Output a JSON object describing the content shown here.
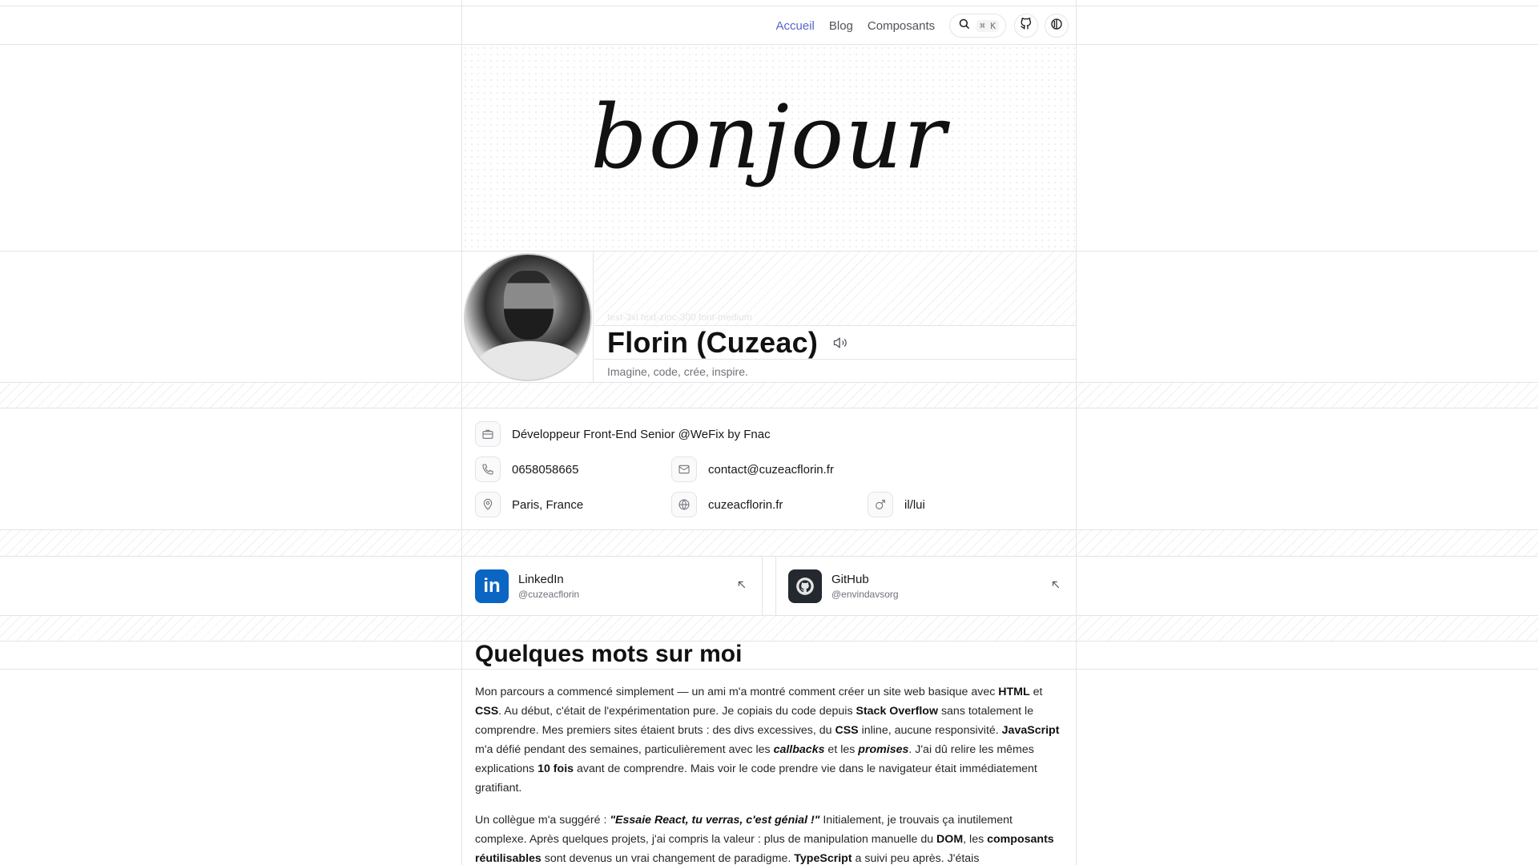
{
  "nav": {
    "links": [
      "Accueil",
      "Blog",
      "Composants"
    ],
    "active": "Accueil",
    "search_kbd": "⌘ K"
  },
  "hero": {
    "word": "bonjour"
  },
  "profile": {
    "tw_label": "text-3xl text-zinc-300 font-medium",
    "name": "Florin (Cuzeac)",
    "tagline": "Imagine, code, crée, inspire."
  },
  "info": {
    "job": "Développeur Front-End Senior @WeFix by Fnac",
    "phone": "0658058665",
    "email": "contact@cuzeacflorin.fr",
    "location": "Paris, France",
    "website": "cuzeacflorin.fr",
    "pronouns": "il/lui"
  },
  "social": [
    {
      "title": "LinkedIn",
      "handle": "@cuzeacflorin",
      "color": "#0a66c2"
    },
    {
      "title": "GitHub",
      "handle": "@envindavsorg",
      "color": "#24292f"
    }
  ],
  "about": {
    "title": "Quelques mots sur moi",
    "p1": [
      "Mon parcours a commencé simplement — un ami m'a montré comment créer un site web basique avec ",
      "HTML",
      " et ",
      "CSS",
      ". Au début, c'était de l'expérimentation pure. Je copiais du code depuis ",
      "Stack Overflow",
      " sans totalement le comprendre. Mes premiers sites étaient bruts : des divs excessives, du ",
      "CSS",
      " inline, aucune responsivité. ",
      "JavaScript",
      " m'a défié pendant des semaines, particulièrement avec les ",
      "callbacks",
      " et les ",
      "promises",
      ". J'ai dû relire les mêmes explications ",
      "10 fois",
      " avant de comprendre. Mais voir le code prendre vie dans le navigateur était immédiatement gratifiant."
    ],
    "p2": [
      "Un collègue m'a suggéré : ",
      "\"Essaie React, tu verras, c'est génial !\"",
      " Initialement, je trouvais ça inutilement complexe. Après quelques projets, j'ai compris la valeur : plus de manipulation manuelle du ",
      "DOM",
      ", les ",
      "composants réutilisables",
      " sont devenus un vrai changement de paradigme. ",
      "TypeScript",
      " a suivi peu après. J'étais"
    ]
  }
}
